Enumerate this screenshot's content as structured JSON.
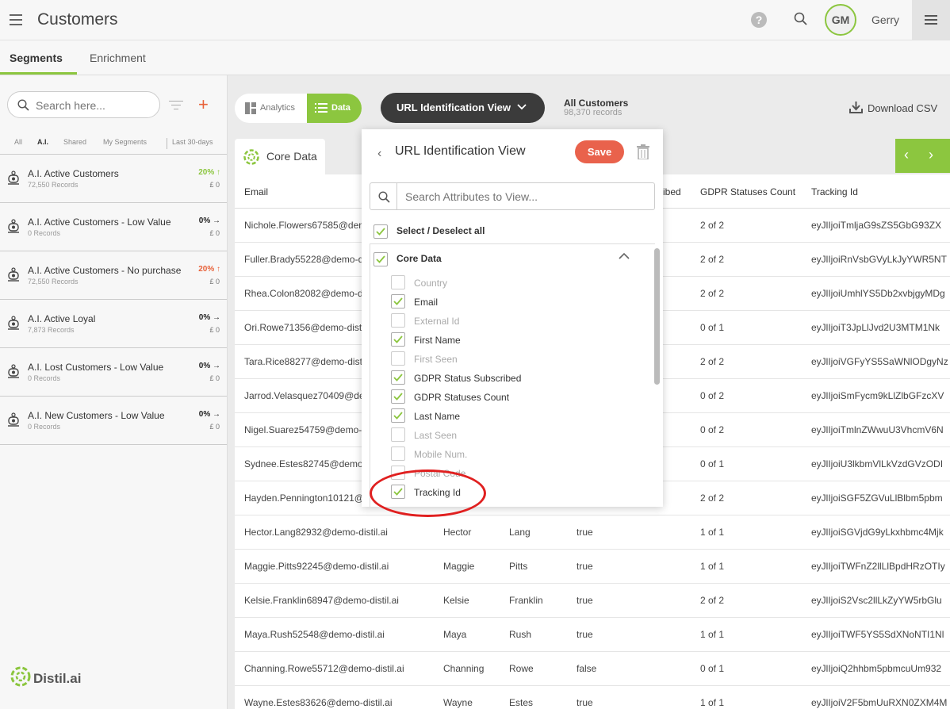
{
  "app": {
    "title": "Customers"
  },
  "user": {
    "initials": "GM",
    "name": "Gerry"
  },
  "subtabs": [
    "Segments",
    "Enrichment"
  ],
  "sidebar": {
    "search_placeholder": "Search here...",
    "filters": [
      "All",
      "A.I.",
      "Shared",
      "My Segments",
      "Last 30-days"
    ],
    "segments": [
      {
        "name": "A.I. Active Customers",
        "records": "72,550 Records",
        "pct": "20%",
        "trend": "up",
        "money": "£ 0"
      },
      {
        "name": "A.I. Active Customers - Low Value",
        "records": "0 Records",
        "pct": "0%",
        "trend": "right",
        "money": "£ 0"
      },
      {
        "name": "A.I. Active Customers - No purchase",
        "records": "72,550 Records",
        "pct": "20%",
        "trend": "up",
        "money": "£ 0"
      },
      {
        "name": "A.I. Active Loyal",
        "records": "7,873 Records",
        "pct": "0%",
        "trend": "right",
        "money": "£ 0"
      },
      {
        "name": "A.I. Lost Customers - Low Value",
        "records": "0 Records",
        "pct": "0%",
        "trend": "right",
        "money": "£ 0"
      },
      {
        "name": "A.I. New Customers - Low Value",
        "records": "0 Records",
        "pct": "0%",
        "trend": "right",
        "money": "£ 0"
      }
    ],
    "logo_text": "Distil.ai"
  },
  "toolbar": {
    "analytics_label": "Analytics",
    "data_label": "Data",
    "view_label": "URL Identification View",
    "all_customers_label": "All Customers",
    "all_customers_count": "98,370 records",
    "download_label": "Download CSV"
  },
  "table": {
    "tab_label": "Core Data",
    "headers": [
      "Email",
      "ibed",
      "GDPR Statuses Count",
      "Tracking Id"
    ],
    "rows": [
      [
        "Nichole.Flowers67585@dem",
        "",
        "",
        "",
        "2 of 2",
        "eyJlIjoiTmljaG9sZS5GbG93ZX"
      ],
      [
        "Fuller.Brady55228@demo-d",
        "",
        "",
        "",
        "2 of 2",
        "eyJlIjoiRnVsbGVyLkJyYWR5NT"
      ],
      [
        "Rhea.Colon82082@demo-d",
        "",
        "",
        "",
        "2 of 2",
        "eyJlIjoiUmhlYS5Db2xvbjgyMDg"
      ],
      [
        "Ori.Rowe71356@demo-disti",
        "",
        "",
        "",
        "0 of 1",
        "eyJlIjoiT3JpLlJvd2U3MTM1Nk"
      ],
      [
        "Tara.Rice88277@demo-dist",
        "",
        "",
        "",
        "2 of 2",
        "eyJlIjoiVGFyYS5SaWNlODgyNz"
      ],
      [
        "Jarrod.Velasquez70409@de",
        "",
        "",
        "",
        "0 of 2",
        "eyJlIjoiSmFycm9kLlZlbGFzcXV"
      ],
      [
        "Nigel.Suarez54759@demo-",
        "",
        "",
        "",
        "0 of 2",
        "eyJlIjoiTmlnZWwuU3VhcmV6N"
      ],
      [
        "Sydnee.Estes82745@demo",
        "",
        "",
        "",
        "0 of 1",
        "eyJlIjoiU3lkbmVlLkVzdGVzODI"
      ],
      [
        "Hayden.Pennington10121@",
        "",
        "",
        "",
        "2 of 2",
        "eyJlIjoiSGF5ZGVuLlBlbm5pbm"
      ],
      [
        "Hector.Lang82932@demo-distil.ai",
        "Hector",
        "Lang",
        "true",
        "1 of 1",
        "eyJlIjoiSGVjdG9yLkxhbmc4Mjk"
      ],
      [
        "Maggie.Pitts92245@demo-distil.ai",
        "Maggie",
        "Pitts",
        "true",
        "1 of 1",
        "eyJlIjoiTWFnZ2llLlBpdHRzOTIy"
      ],
      [
        "Kelsie.Franklin68947@demo-distil.ai",
        "Kelsie",
        "Franklin",
        "true",
        "2 of 2",
        "eyJlIjoiS2Vsc2llLkZyYW5rbGlu"
      ],
      [
        "Maya.Rush52548@demo-distil.ai",
        "Maya",
        "Rush",
        "true",
        "1 of 1",
        "eyJlIjoiTWF5YS5SdXNoNTI1Nl"
      ],
      [
        "Channing.Rowe55712@demo-distil.ai",
        "Channing",
        "Rowe",
        "false",
        "0 of 1",
        "eyJlIjoiQ2hhbm5pbmcuUm932"
      ],
      [
        "Wayne.Estes83626@demo-distil.ai",
        "Wayne",
        "Estes",
        "true",
        "1 of 1",
        "eyJlIjoiV2F5bmUuRXN0ZXM4M"
      ]
    ]
  },
  "panel": {
    "title": "URL Identification View",
    "save_label": "Save",
    "search_placeholder": "Search Attributes to View...",
    "select_all_label": "Select / Deselect all",
    "group_label": "Core Data",
    "attributes": [
      {
        "label": "Country",
        "checked": false
      },
      {
        "label": "Email",
        "checked": true
      },
      {
        "label": "External Id",
        "checked": false
      },
      {
        "label": "First Name",
        "checked": true
      },
      {
        "label": "First Seen",
        "checked": false
      },
      {
        "label": "GDPR Status Subscribed",
        "checked": true
      },
      {
        "label": "GDPR Statuses Count",
        "checked": true
      },
      {
        "label": "Last Name",
        "checked": true
      },
      {
        "label": "Last Seen",
        "checked": false
      },
      {
        "label": "Mobile Num.",
        "checked": false
      },
      {
        "label": "Postal Code",
        "checked": false
      },
      {
        "label": "Tracking Id",
        "checked": true
      }
    ]
  },
  "colors": {
    "accent_green": "#8cc63f",
    "save_red": "#e9624c",
    "annotation_red": "#e02020",
    "trend_up_green": "#8cc63f",
    "trend_up_orange": "#e8623a"
  }
}
